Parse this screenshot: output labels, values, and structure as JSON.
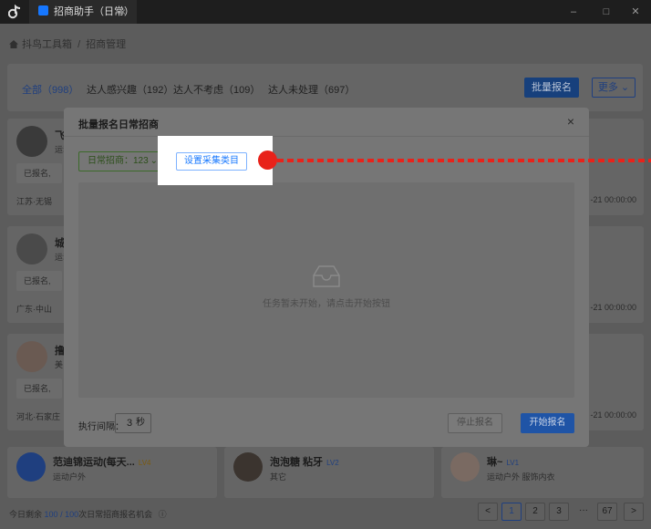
{
  "window": {
    "tab_title": "招商助手（日常）",
    "tab_close": "×",
    "minimize": "–",
    "maximize": "□",
    "close": "✕"
  },
  "breadcrumb": {
    "root": "抖鸟工具箱",
    "sep": "/",
    "current": "招商管理"
  },
  "filters": [
    {
      "label": "全部（998）"
    },
    {
      "label": "达人感兴趣（192）"
    },
    {
      "label": "达人不考虑（109）"
    },
    {
      "label": "达人未处理（697）"
    }
  ],
  "toolbar": {
    "batch": "批量报名",
    "more": "更多"
  },
  "cards": [
    {
      "name": "飞",
      "cat": "运动",
      "status": "已报名,",
      "loc": "江苏·无锡",
      "time": "-21 00:00:00"
    },
    {
      "name": "城",
      "cat": "运动",
      "status": "已报名,",
      "loc": "广东·中山",
      "time": "-21 00:00:00"
    },
    {
      "name": "撸",
      "cat": "美",
      "status": "已报名,",
      "loc": "河北·石家庄",
      "time": "-21 00:00:00"
    }
  ],
  "bottom_cards": [
    {
      "name": "范迪锦运动(每天...",
      "level": "LV4",
      "cat": "运动户外"
    },
    {
      "name": "泡泡糖 粘牙",
      "level": "LV2",
      "cat": "其它"
    },
    {
      "name": "琳~",
      "level": "LV1",
      "cat": "运动户外 服饰内衣"
    }
  ],
  "footer": {
    "prefix": "今日剩余",
    "remaining": "100",
    "sep": "/",
    "total": "100",
    "suffix": "次日常招商报名机会"
  },
  "pagination": {
    "prev": "<",
    "pages": [
      "1",
      "2",
      "3"
    ],
    "ellipsis": "···",
    "last": "67",
    "next": ">"
  },
  "modal": {
    "title": "批量报名日常招商",
    "close": "×",
    "select_value": "日常招商：123",
    "config_button": "设置采集类目",
    "empty_text": "任务暂未开始，请点击开始按钮",
    "interval_label": "执行间隔：",
    "interval_value": "3",
    "interval_unit": "秒",
    "stop_button": "停止报名",
    "start_button": "开始报名"
  }
}
